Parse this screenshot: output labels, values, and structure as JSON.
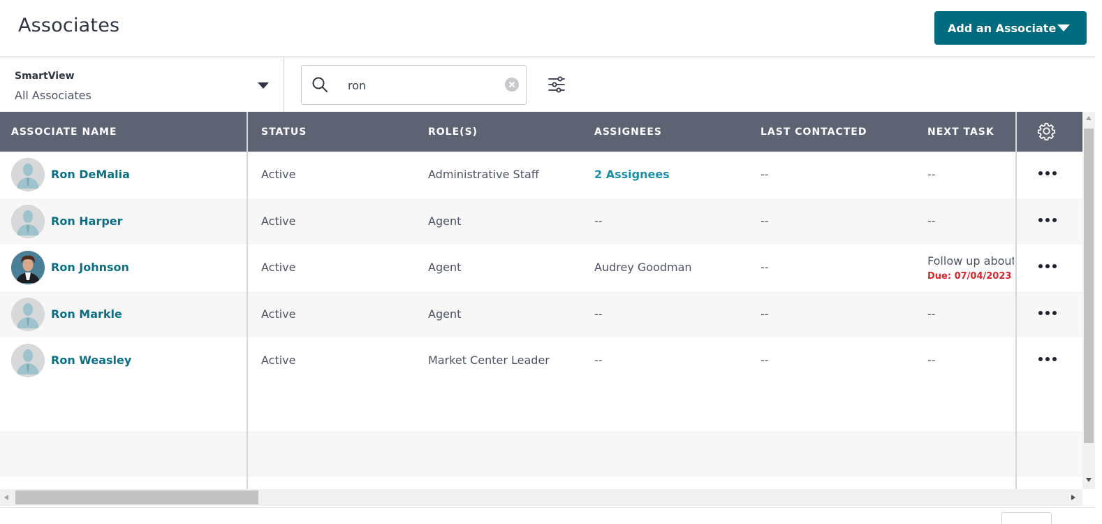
{
  "header": {
    "title": "Associates",
    "add_button_label": "Add an Associate"
  },
  "toolbar": {
    "smartview_label": "SmartView",
    "smartview_value": "All Associates",
    "search_value": "ron"
  },
  "table": {
    "columns": [
      "ASSOCIATE NAME",
      "STATUS",
      "ROLE(S)",
      "ASSIGNEES",
      "LAST CONTACTED",
      "NEXT TASK"
    ],
    "rows": [
      {
        "name": "Ron DeMalia",
        "status": "Active",
        "role": "Administrative Staff",
        "assignees": "2 Assignees",
        "last_contacted": "--",
        "next_task": "--",
        "due": ""
      },
      {
        "name": "Ron Harper",
        "status": "Active",
        "role": "Agent",
        "assignees": "--",
        "last_contacted": "--",
        "next_task": "--",
        "due": ""
      },
      {
        "name": "Ron Johnson",
        "status": "Active",
        "role": "Agent",
        "assignees": "Audrey Goodman",
        "last_contacted": "--",
        "next_task": "Follow up about",
        "due": "Due: 07/04/2023"
      },
      {
        "name": "Ron Markle",
        "status": "Active",
        "role": "Agent",
        "assignees": "--",
        "last_contacted": "--",
        "next_task": "--",
        "due": ""
      },
      {
        "name": "Ron Weasley",
        "status": "Active",
        "role": "Market Center Leader",
        "assignees": "--",
        "last_contacted": "--",
        "next_task": "--",
        "due": ""
      }
    ]
  },
  "colors": {
    "primary": "#006c80",
    "header_bg": "#5e6374",
    "link": "#0c6e83",
    "due": "#d9262d"
  },
  "icons": [
    "caret-down-icon",
    "search-icon",
    "clear-icon",
    "filter-sliders-icon",
    "gear-icon",
    "more-icon",
    "avatar-placeholder-icon"
  ]
}
